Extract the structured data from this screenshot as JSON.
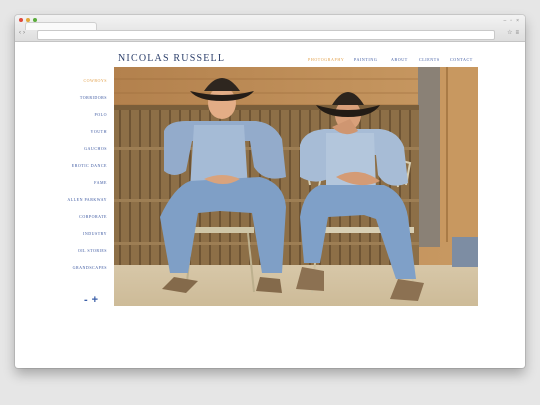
{
  "site": {
    "title": "NICOLAS RUSSELL"
  },
  "top_nav": [
    {
      "label": "PHOTOGRAPHY",
      "active": true
    },
    {
      "label": "PAINTING",
      "active": false
    },
    {
      "label": "ABOUT",
      "active": false
    },
    {
      "label": "CLIENTS",
      "active": false
    },
    {
      "label": "CONTACT",
      "active": false
    }
  ],
  "side_nav": [
    {
      "label": "COWBOYS",
      "active": true
    },
    {
      "label": "TORRIDORS",
      "active": false
    },
    {
      "label": "POLO",
      "active": false
    },
    {
      "label": "YOUTH",
      "active": false
    },
    {
      "label": "GAUCHOS",
      "active": false
    },
    {
      "label": "EROTIC DANCE",
      "active": false
    },
    {
      "label": "FAME",
      "active": false
    },
    {
      "label": "ALLEN PARKWAY",
      "active": false
    },
    {
      "label": "CORPORATE",
      "active": false
    },
    {
      "label": "INDUSTRY",
      "active": false
    },
    {
      "label": "OIL STORIES",
      "active": false
    },
    {
      "label": "GRANDSCAPES",
      "active": false
    }
  ],
  "zoom": {
    "minus": "-",
    "plus": "+"
  },
  "colors": {
    "accent": "#e2a04a",
    "link": "#3b57a0",
    "title": "#2c3f6b"
  },
  "browser": {
    "close": "#e0493b",
    "minimize": "#e0a83a",
    "maximize": "#5aab3b"
  }
}
